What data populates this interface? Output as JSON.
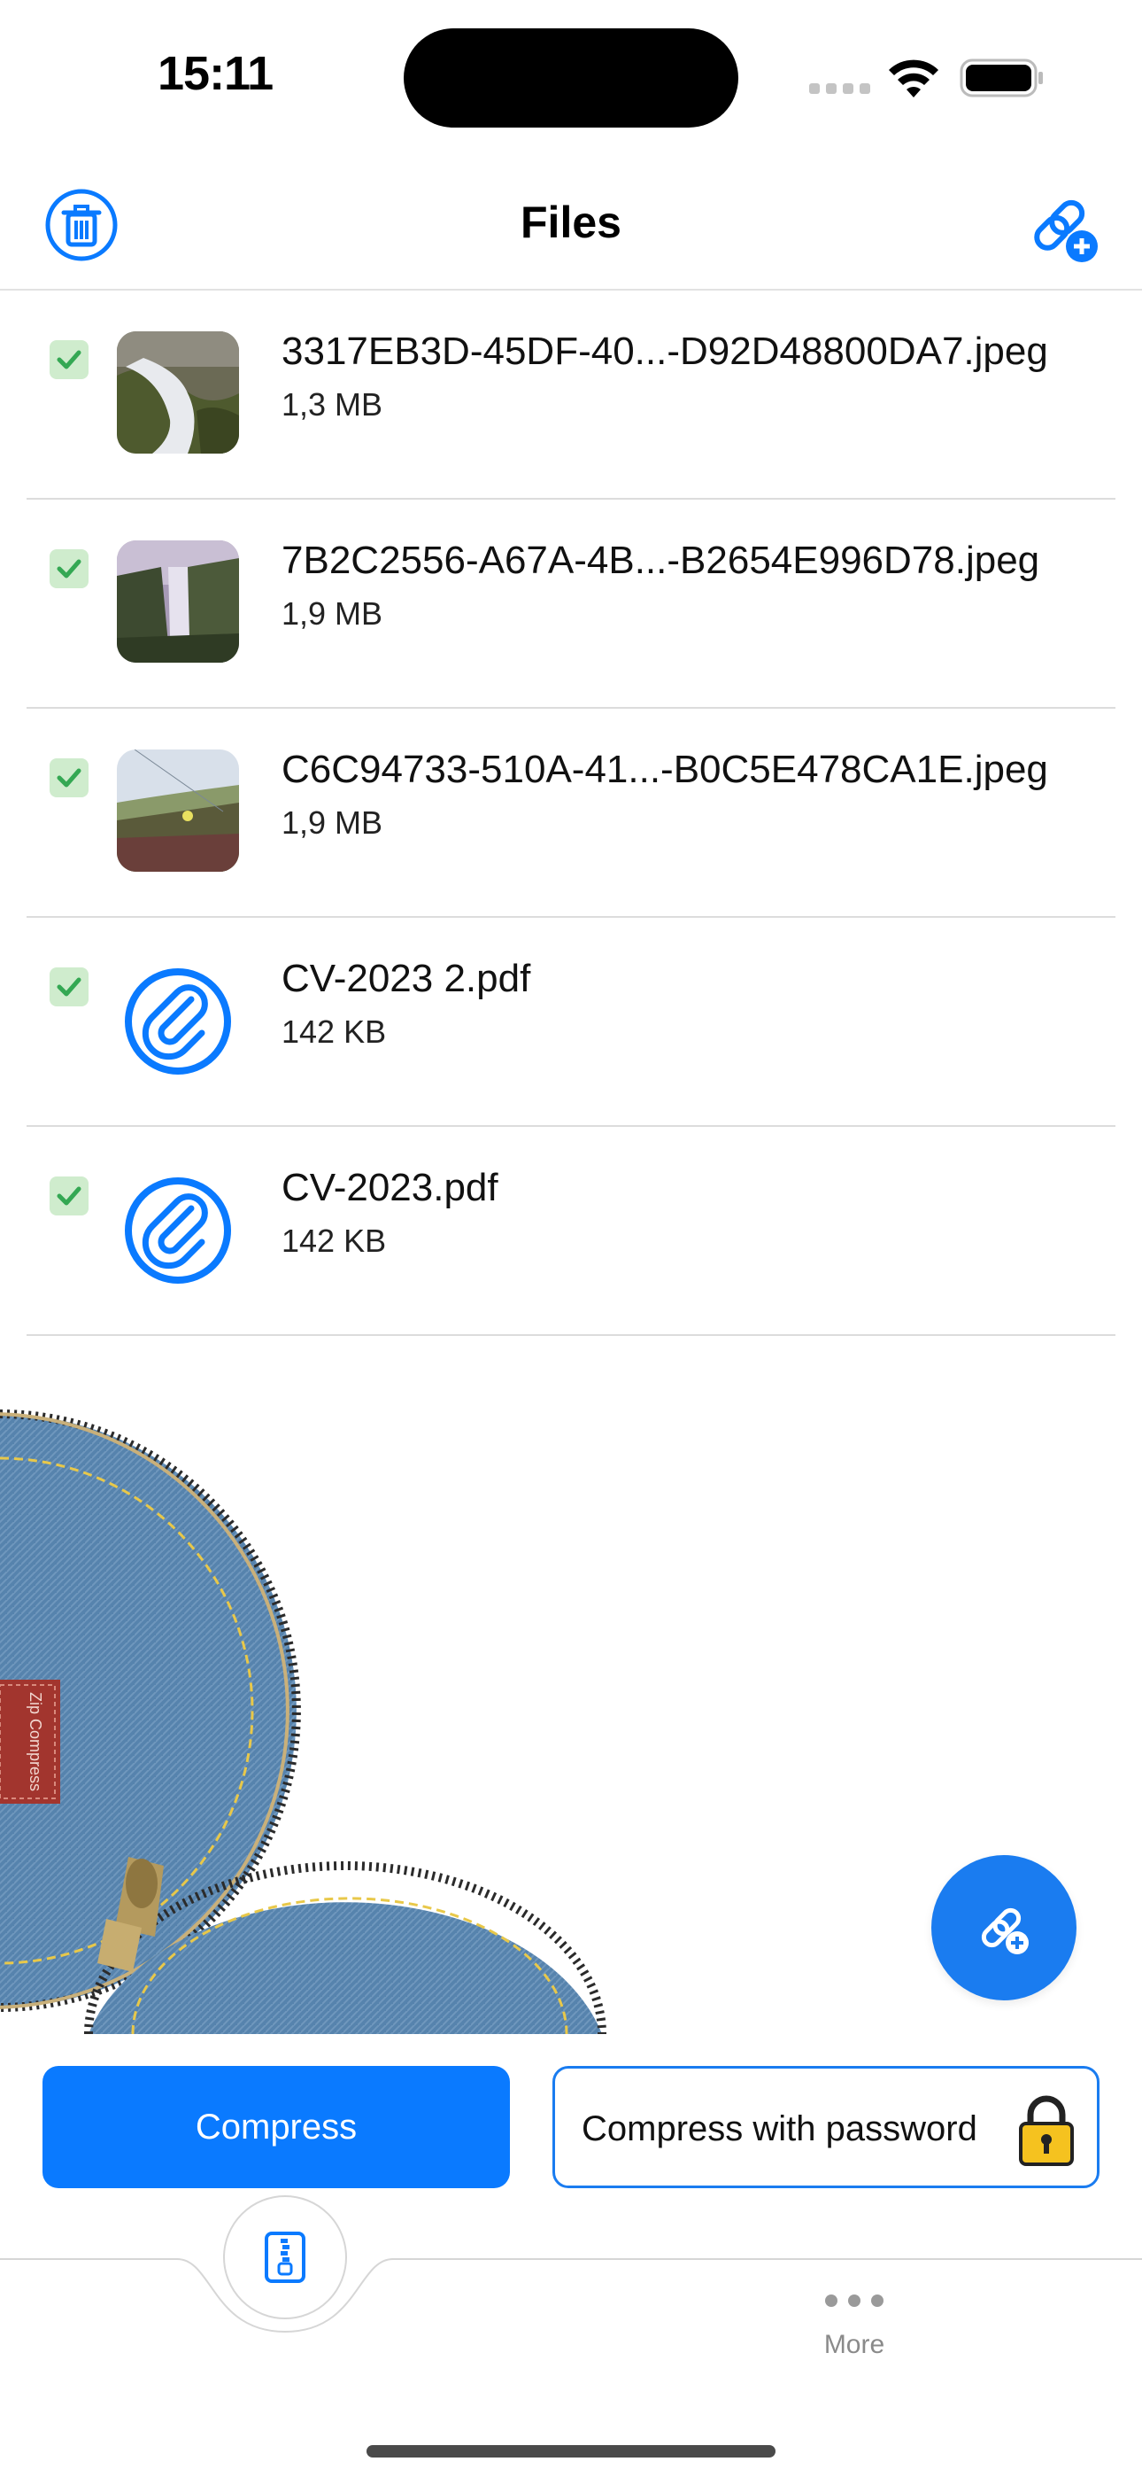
{
  "status_bar": {
    "time": "15:11"
  },
  "nav": {
    "title": "Files"
  },
  "files": [
    {
      "name": "3317EB3D-45DF-40...-D92D48800DA7.jpeg",
      "size": "1,3 MB",
      "type": "image",
      "checked": true
    },
    {
      "name": "7B2C2556-A67A-4B...-B2654E996D78.jpeg",
      "size": "1,9 MB",
      "type": "image",
      "checked": true
    },
    {
      "name": "C6C94733-510A-41...-B0C5E478CA1E.jpeg",
      "size": "1,9 MB",
      "type": "image",
      "checked": true
    },
    {
      "name": "CV-2023 2.pdf",
      "size": "142 KB",
      "type": "pdf",
      "checked": true
    },
    {
      "name": "CV-2023.pdf",
      "size": "142 KB",
      "type": "pdf",
      "checked": true
    }
  ],
  "decoration": {
    "label": "Zip Compress"
  },
  "actions": {
    "compress_label": "Compress",
    "compress_password_label": "Compress with password"
  },
  "tabbar": {
    "more_label": "More"
  },
  "colors": {
    "accent": "#0a7aff",
    "check_bg": "#cfeccd",
    "check_mark": "#34a853",
    "denim": "#4f7fa8"
  },
  "icons": {
    "trash": "trash-icon",
    "link_add": "link-add-icon",
    "paperclip": "paperclip-icon",
    "zip": "zip-file-icon",
    "lock": "lock-icon",
    "more": "more-dots-icon"
  }
}
